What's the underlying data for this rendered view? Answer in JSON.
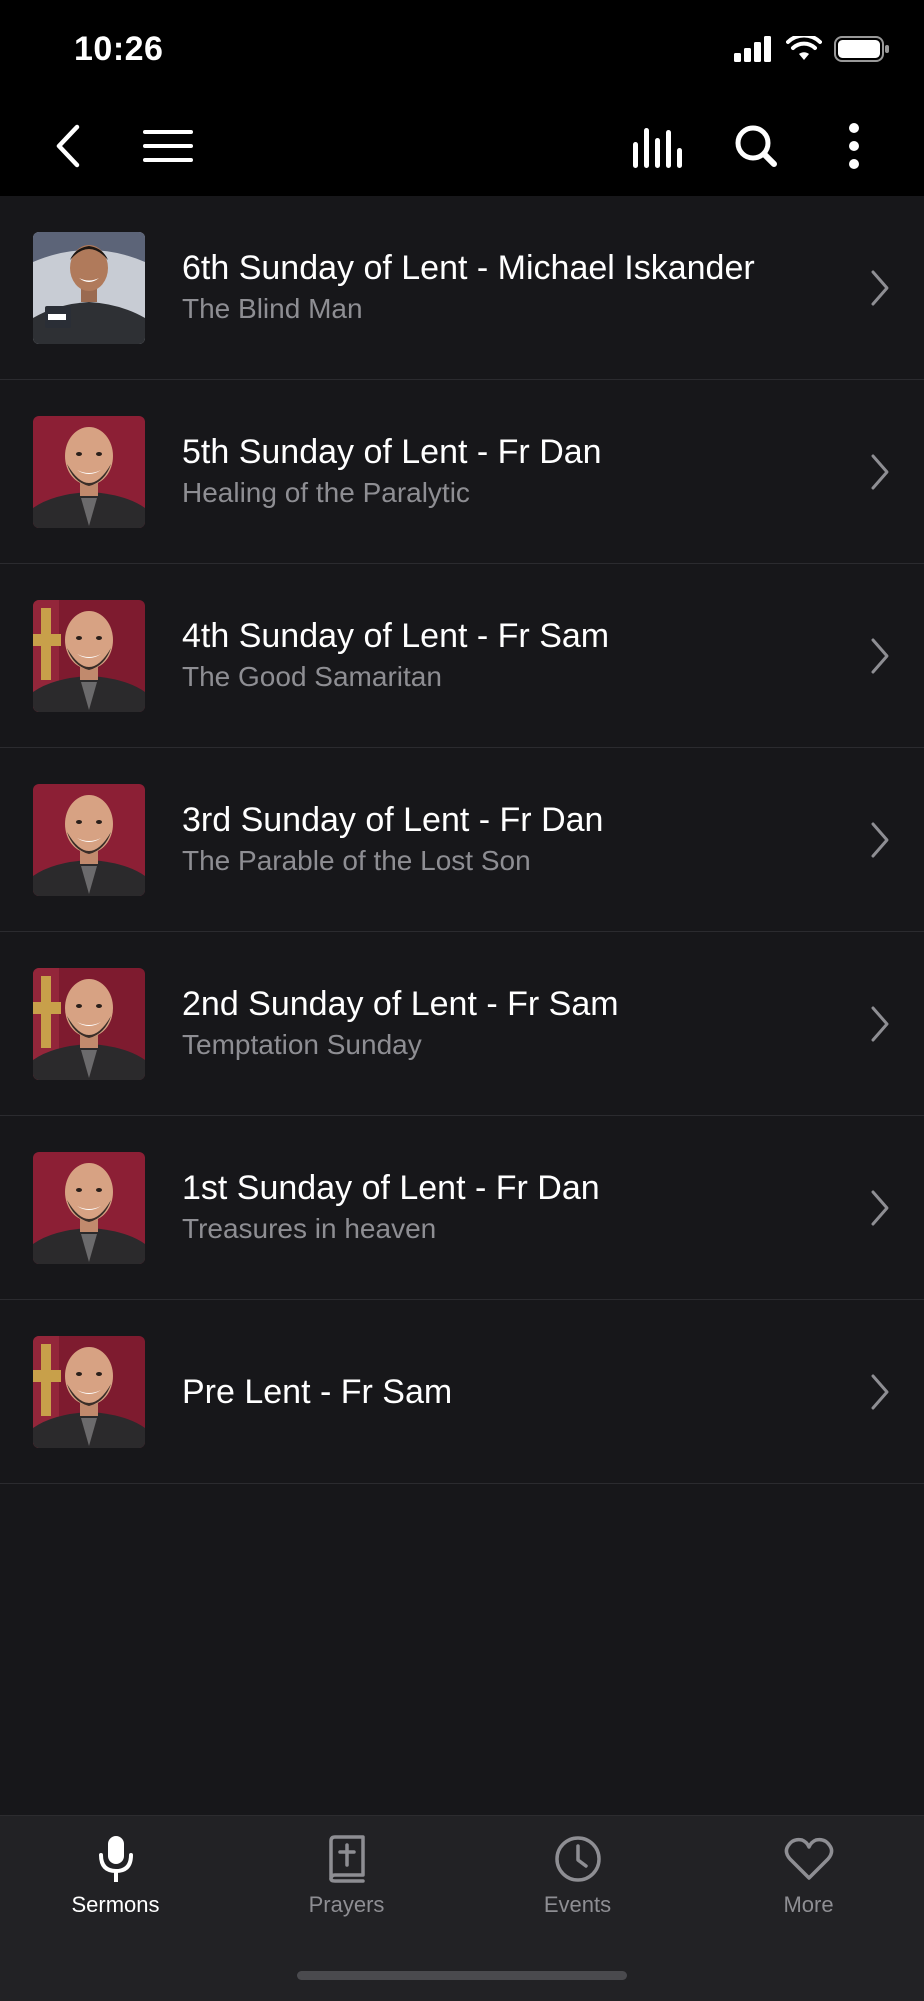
{
  "status_bar": {
    "time": "10:26"
  },
  "nav": {
    "icons": [
      "back-chevron-icon",
      "menu-icon",
      "audio-bars-icon",
      "search-icon",
      "more-vertical-icon"
    ]
  },
  "sermons": [
    {
      "title": "6th Sunday of Lent - Michael Iskander",
      "subtitle": "The Blind Man",
      "thumb": "speaker-young"
    },
    {
      "title": "5th Sunday of Lent - Fr Dan",
      "subtitle": "Healing of the Paralytic",
      "thumb": "priest-red"
    },
    {
      "title": "4th Sunday of Lent - Fr Sam",
      "subtitle": "The Good Samaritan",
      "thumb": "priest-cross"
    },
    {
      "title": "3rd Sunday of Lent - Fr Dan",
      "subtitle": "The Parable of the Lost Son",
      "thumb": "priest-red"
    },
    {
      "title": "2nd Sunday of Lent - Fr Sam",
      "subtitle": "Temptation Sunday",
      "thumb": "priest-cross"
    },
    {
      "title": "1st Sunday of Lent - Fr Dan",
      "subtitle": "Treasures in heaven",
      "thumb": "priest-red"
    },
    {
      "title": "Pre Lent - Fr Sam",
      "subtitle": "",
      "thumb": "priest-cross"
    }
  ],
  "tabs": [
    {
      "label": "Sermons",
      "icon": "microphone-icon",
      "active": true
    },
    {
      "label": "Prayers",
      "icon": "bible-icon",
      "active": false
    },
    {
      "label": "Events",
      "icon": "clock-icon",
      "active": false
    },
    {
      "label": "More",
      "icon": "heart-icon",
      "active": false
    }
  ],
  "colors": {
    "background": "#17171a",
    "header": "#000000",
    "tab_bar": "#222225",
    "secondary_text": "#8e8e93",
    "separator": "#2b2b2f"
  }
}
